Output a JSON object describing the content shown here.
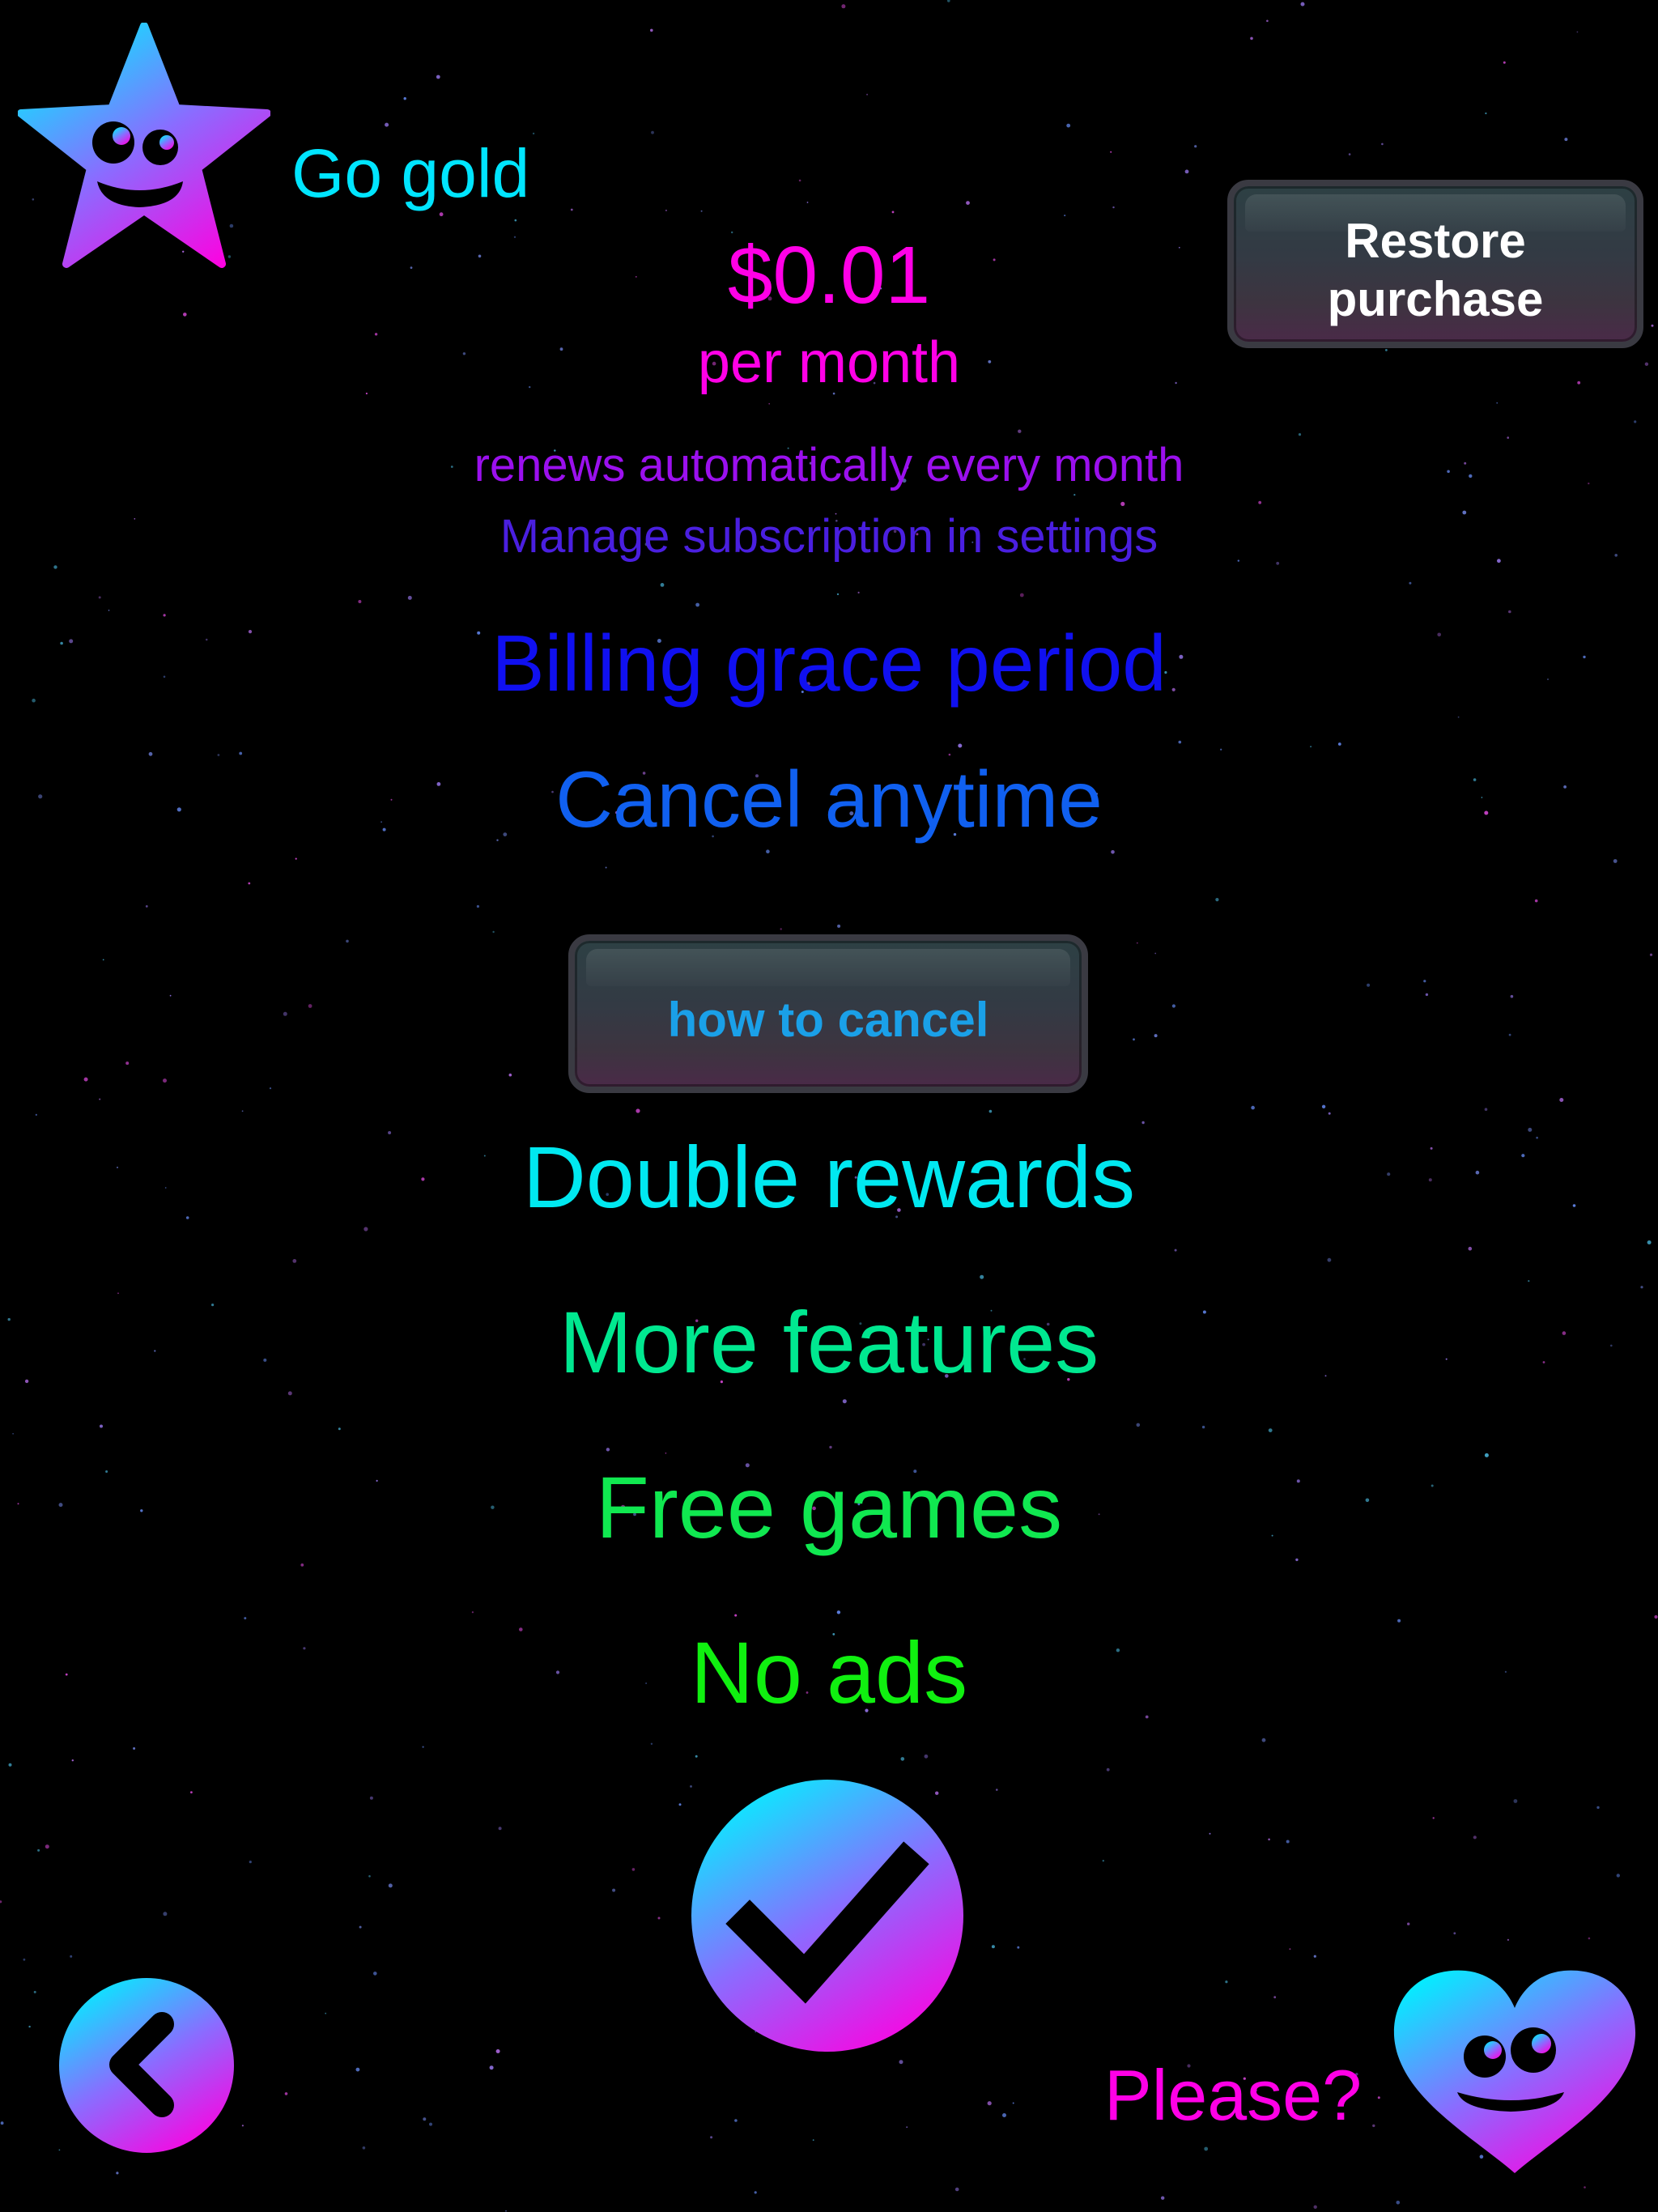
{
  "header": {
    "title": "Go gold",
    "restore_label_line1": "Restore",
    "restore_label_line2": "purchase"
  },
  "pricing": {
    "price": "$0.01",
    "period": "per month",
    "renewal_note": "renews automatically every month",
    "manage_note": "Manage subscription in settings"
  },
  "terms": {
    "grace": "Billing grace period",
    "cancel": "Cancel anytime",
    "how_to_cancel_label": "how to cancel"
  },
  "benefits": [
    "Double rewards",
    "More features",
    "Free games",
    "No ads"
  ],
  "footer": {
    "please_text": "Please?"
  },
  "icons": {
    "mascot": "star-mascot-icon",
    "confirm": "checkmark-icon",
    "back": "chevron-left-icon",
    "heart": "heart-mascot-icon"
  },
  "colors": {
    "cyan": "#00E5FF",
    "magenta": "#FF00E6",
    "purple": "#9B10EE",
    "indigo": "#4A1FE0",
    "blue": "#1010F0",
    "royal": "#1060F0",
    "sky": "#1AA0E8",
    "aqua": "#00E8F0",
    "mint": "#00E890",
    "green": "#10E850",
    "lime": "#10F010"
  }
}
